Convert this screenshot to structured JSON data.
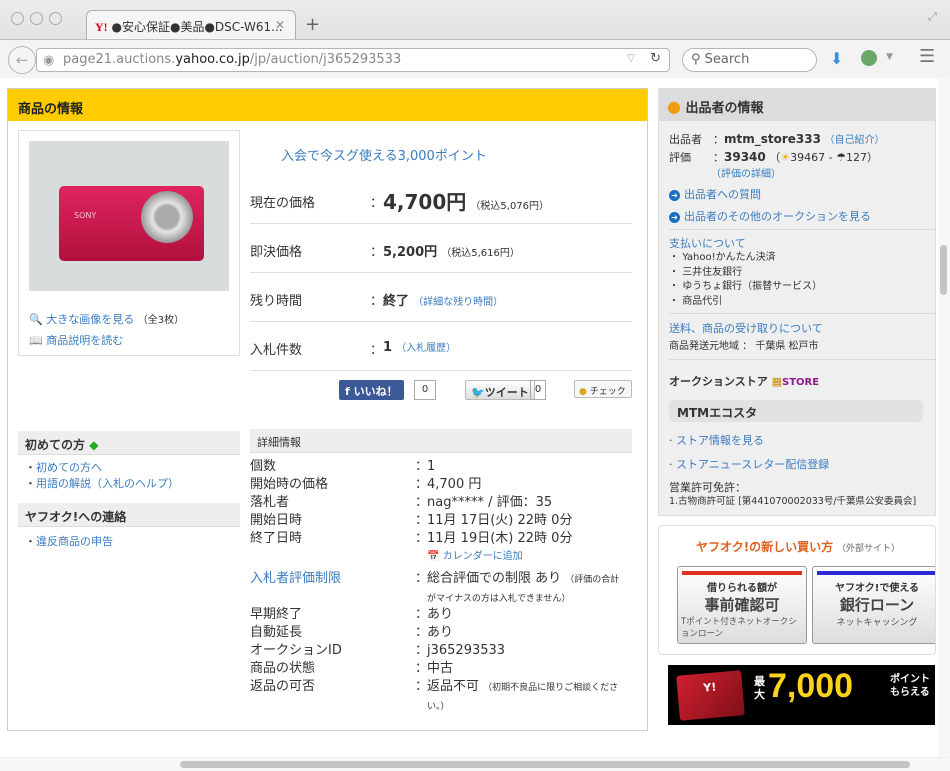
{
  "browser": {
    "tab_title": "●安心保証●美品●DSC-W61...",
    "url_prefix": "page21.auctions.",
    "url_domain": "yahoo.co.jp",
    "url_path": "/jp/auction/j365293533",
    "search_placeholder": "Search",
    "tab_favicon": "Y!"
  },
  "product": {
    "section_title": "商品の情報",
    "view_large": "大きな画像を見る",
    "image_count": "（全3枚）",
    "read_desc": "商品説明を読む",
    "promo": "入会で今スグ使える3,000ポイント",
    "rows": [
      {
        "label": "現在の価格",
        "value": "4,700円",
        "note": "（税込5,076円）"
      },
      {
        "label": "即決価格",
        "value": "5,200円",
        "note": "（税込5,616円）"
      },
      {
        "label": "残り時間",
        "value": "終了",
        "note": "（詳細な残り時間）"
      },
      {
        "label": "入札件数",
        "value": "1",
        "note": "（入札履歴）"
      }
    ],
    "social": {
      "like": "いいね！",
      "like_count": "0",
      "tweet": "ツイート",
      "tweet_count": "0",
      "check": "チェック"
    }
  },
  "left_nav": {
    "beginner_title": "初めての方",
    "beginner_links": [
      "初めての方へ",
      "用語の解説（入札のヘルプ）"
    ],
    "contact_title": "ヤフオク!への連絡",
    "contact_links": [
      "違反商品の申告"
    ]
  },
  "details": {
    "title": "詳細情報",
    "calendar": "カレンダーに追加",
    "rows": [
      {
        "k": "個数",
        "v": "1"
      },
      {
        "k": "開始時の価格",
        "v": "4,700 円"
      },
      {
        "k": "落札者",
        "v": "nag***** / 評価：35"
      },
      {
        "k": "開始日時",
        "v": "11月 17日(火) 22時 0分"
      },
      {
        "k": "終了日時",
        "v": "11月 19日(木) 22時 0分"
      }
    ],
    "restriction": {
      "k": "入札者評価制限",
      "v": "総合評価での制限 あり",
      "note1": "（評価の合計",
      "note2": "がマイナスの方は入札できません）"
    },
    "rows2": [
      {
        "k": "早期終了",
        "v": "あり"
      },
      {
        "k": "自動延長",
        "v": "あり"
      },
      {
        "k": "オークションID",
        "v": "j365293533"
      },
      {
        "k": "商品の状態",
        "v": "中古"
      }
    ],
    "return": {
      "k": "返品の可否",
      "v": "返品不可",
      "note1": "（初期不良品に限りご相談くださ",
      "note2": "い。）"
    },
    "colon": "："
  },
  "seller": {
    "title": "出品者の情報",
    "seller_label": "出品者",
    "seller_name": "mtm_store333",
    "self_intro": "（自己紹介）",
    "rating_label": "評価",
    "rating": "39340",
    "good": "39467",
    "bad": "127",
    "rating_detail": "（評価の詳細）",
    "ask": "出品者への質問",
    "other_auctions": "出品者のその他のオークションを見る",
    "payment_title": "支払いについて",
    "payments": [
      "Yahoo!かんたん決済",
      "三井住友銀行",
      "ゆうちょ銀行（振替サービス）",
      "商品代引"
    ],
    "shipping_title": "送料、商品の受け取りについて",
    "ship_from_label": "商品発送元地域",
    "ship_from": "千葉県 松戸市",
    "store_label": "オークションストア",
    "store_badge": "STORE",
    "store_name": "MTMエコスタ",
    "store_links": [
      "ストア情報を見る",
      "ストアニュースレター配信登録"
    ],
    "license_label": "営業許可免許：",
    "license": "1.古物商許可証 [第441070002033号/千葉県公安委員会]"
  },
  "ads": {
    "title": "ヤフオク!の新しい買い方",
    "external": "（外部サイト）",
    "card1": {
      "top": "借りられる額が",
      "big": "事前確認可",
      "sub": "Tポイント付きネットオークションローン"
    },
    "card2": {
      "top": "ヤフオク!で使える",
      "big": "銀行ローン",
      "sub": "ネットキャッシング"
    },
    "banner": {
      "prefix": "最大",
      "amount": "7,000",
      "suffix1": "ポイント",
      "suffix2": "もらえる"
    }
  },
  "colors": {
    "yellow": "#ffcc00",
    "link": "#3a7cc0",
    "ad_title": "#e0601c"
  }
}
